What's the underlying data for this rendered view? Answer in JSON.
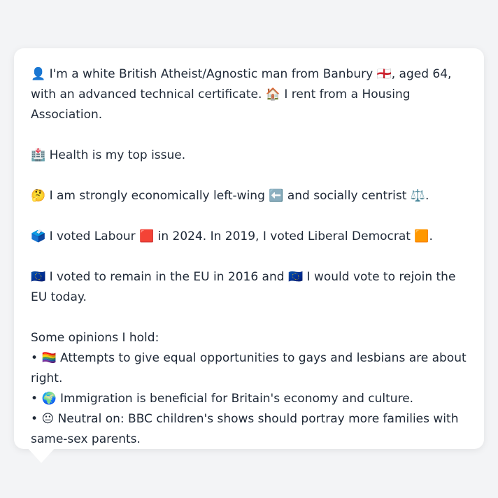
{
  "profile": {
    "intro_emoji": "👤",
    "intro_a": "I'm a white British Atheist/Agnostic man from Banbury",
    "intro_flag": "🏴󠁧󠁢󠁥󠁮󠁧󠁿",
    "intro_b": ", aged 64, with an advanced technical certificate.",
    "housing_emoji": "🏠",
    "housing": "I rent from a Housing Association.",
    "health_emoji": "🏥",
    "health": "Health is my top issue.",
    "politics_emoji": "🤔",
    "politics_a": "I am strongly economically left-wing",
    "left_emoji": "⬅️",
    "politics_b": "and socially centrist",
    "scales_emoji": "⚖️",
    "politics_end": ".",
    "vote_emoji": "🗳️",
    "vote_a": "I voted Labour",
    "labour_emoji": "🟥",
    "vote_b": "in 2024. In 2019, I voted Liberal Democrat",
    "libdem_emoji": "🟧",
    "vote_end": ".",
    "eu_emoji1": "🇪🇺",
    "eu_a": "I voted to remain in the EU in 2016 and",
    "eu_emoji2": "🇪🇺",
    "eu_b": "I would vote to rejoin the EU today."
  },
  "opinions": {
    "heading": "Some opinions I hold:",
    "items": [
      {
        "bullet": "•",
        "emoji": "🏳️‍🌈",
        "text": "Attempts to give equal opportunities to gays and lesbians are about right."
      },
      {
        "bullet": "•",
        "emoji": "🌍",
        "text": "Immigration is beneficial for Britain's economy and culture."
      },
      {
        "bullet": "•",
        "emoji": "😐",
        "text": "Neutral on: BBC children's shows should portray more families with same-sex parents."
      }
    ]
  }
}
